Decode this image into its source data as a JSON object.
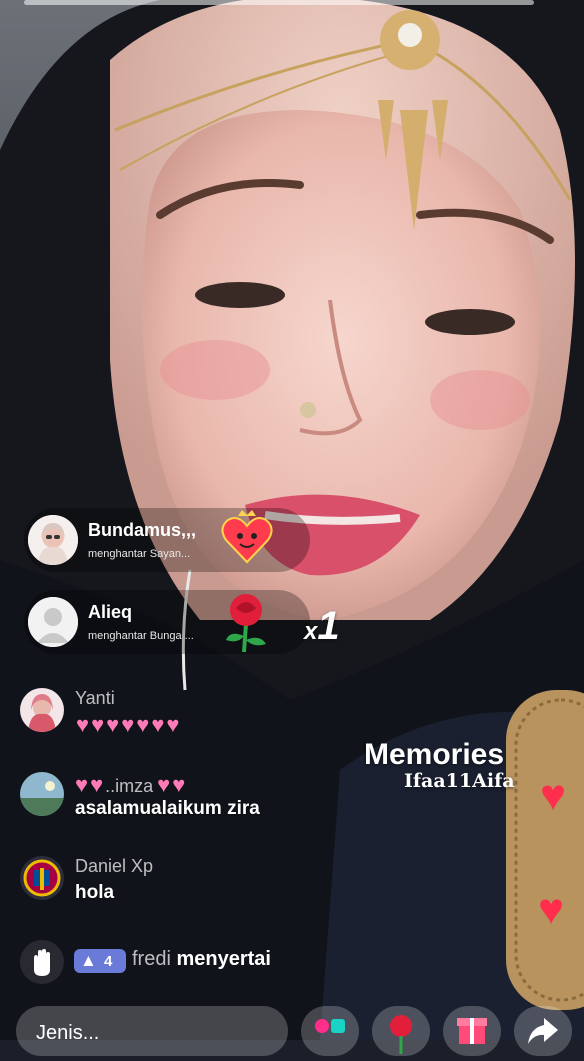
{
  "gifts": [
    {
      "user": "Bundamus,,,",
      "action": "menghantar Sayan..."
    },
    {
      "user": "Alieq",
      "action": "menghantar Bunga ..."
    }
  ],
  "combo": {
    "prefix": "x",
    "count": "1"
  },
  "chat": [
    {
      "user": "Yanti",
      "message": "",
      "hearts": 7
    },
    {
      "user": "..imza",
      "message": "asalamualaikum zira",
      "hearts": 4
    },
    {
      "user": "Daniel Xp",
      "message": "hola",
      "hearts": 0
    }
  ],
  "join": {
    "level": "4",
    "user": "fredi",
    "text": "menyertai"
  },
  "watermark": {
    "line1": "Memories",
    "line2": "Ifaa11Aifa"
  },
  "input": {
    "placeholder": "Jenis..."
  },
  "icons": [
    "wave-hand-icon",
    "level-triangle-icon",
    "rose-icon",
    "heart-gift-icon",
    "gift-box-icon",
    "share-icon"
  ],
  "colors": {
    "heart_pink": "#ff7bb8",
    "level_badge": "#6a7ad8",
    "red_heart": "#ff2e4d"
  }
}
